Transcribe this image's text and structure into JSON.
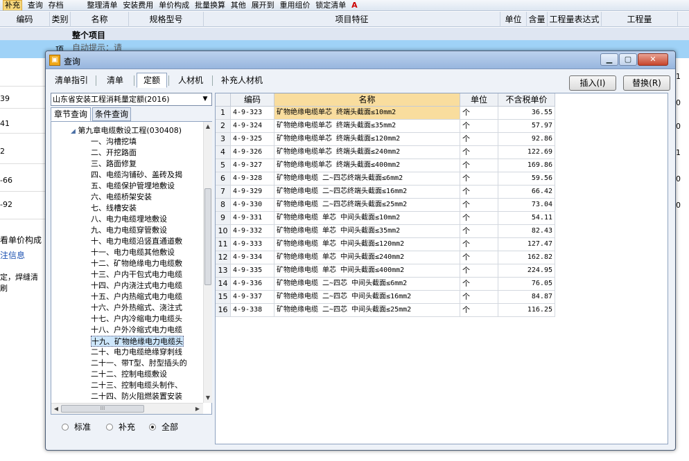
{
  "bg": {
    "toolbar_items": [
      "补充",
      "查询",
      "存档",
      "",
      "整理清单",
      "安装费用",
      "单价构成",
      "批量换算",
      "其他",
      "展开到",
      "重用组价",
      "锁定清单",
      "A"
    ],
    "grid_headers": [
      "编码",
      "类别",
      "名称",
      "规格型号",
      "项目特征",
      "单位",
      "含量",
      "工程量表达式",
      "工程量"
    ],
    "total_row": "整个项目",
    "sel_row": {
      "type": "项",
      "hint": "自动提示：请"
    },
    "left_numbers": [
      "39",
      "41",
      "2",
      "-66",
      "-92"
    ],
    "right_numbers": [
      "1",
      "0",
      "0",
      "0",
      "1",
      "0",
      "0"
    ],
    "left_links": [
      "看单价构成",
      "注信息",
      "定，焊缝清刷"
    ]
  },
  "dialog": {
    "title": "查询",
    "tabs": [
      "清单指引",
      "清单",
      "定额",
      "人材机",
      "补充人材机"
    ],
    "active_tab": "定额",
    "insert_btn": "插入(I)",
    "replace_btn": "替换(R)",
    "library": "山东省安装工程消耗量定额(2016)",
    "left_tabs": [
      "章节查询",
      "条件查询"
    ],
    "tree_root": "第九章电缆敷设工程(030408)",
    "tree_items": [
      "一、沟槽挖填",
      "二、开挖路面",
      "三、路面修复",
      "四、电缆沟铺砂、盖砖及揭",
      "五、电缆保护管埋地敷设",
      "六、电缆桥架安装",
      "七、线槽安装",
      "八、电力电缆埋地敷设",
      "九、电力电缆穿管敷设",
      "十、电力电缆沿竖直通道敷",
      "十一、电力电缆其他敷设",
      "十二、矿物绝缘电力电缆敷",
      "十三、户内干包式电力电缆",
      "十四、户内浇注式电力电缆",
      "十五、户内热缩式电力电缆",
      "十六、户外热缩式、浇注式",
      "十七、户内冷缩电力电缆头",
      "十八、户外冷缩式电力电缆",
      "十九、矿物绝缘电力电缆头",
      "二十、电力电缆绝缘穿刺线",
      "二十一、带T型、肘型插头的",
      "二十二、控制电缆敷设",
      "二十三、控制电缆头制作、",
      "二十四、防火阻燃装置安装"
    ],
    "selected_tree_index": 18,
    "radios": [
      "标准",
      "补充",
      "全部"
    ],
    "radio_selected": "全部",
    "grid_headers": [
      "编码",
      "名称",
      "单位",
      "不含税单价"
    ],
    "rows": [
      {
        "no": "1",
        "code": "4-9-323",
        "name": "矿物绝缘电缆单芯 终端头截面≤10mm2",
        "unit": "个",
        "price": "36.55"
      },
      {
        "no": "2",
        "code": "4-9-324",
        "name": "矿物绝缘电缆单芯 终端头截面≤35mm2",
        "unit": "个",
        "price": "57.97"
      },
      {
        "no": "3",
        "code": "4-9-325",
        "name": "矿物绝缘电缆单芯 终端头截面≤120mm2",
        "unit": "个",
        "price": "92.86"
      },
      {
        "no": "4",
        "code": "4-9-326",
        "name": "矿物绝缘电缆单芯 终端头截面≤240mm2",
        "unit": "个",
        "price": "122.69"
      },
      {
        "no": "5",
        "code": "4-9-327",
        "name": "矿物绝缘电缆单芯 终端头截面≤400mm2",
        "unit": "个",
        "price": "169.86"
      },
      {
        "no": "6",
        "code": "4-9-328",
        "name": "矿物绝缘电缆 二~四芯终端头截面≤6mm2",
        "unit": "个",
        "price": "59.56"
      },
      {
        "no": "7",
        "code": "4-9-329",
        "name": "矿物绝缘电缆 二~四芯终端头截面≤16mm2",
        "unit": "个",
        "price": "66.42"
      },
      {
        "no": "8",
        "code": "4-9-330",
        "name": "矿物绝缘电缆 二~四芯终端头截面≤25mm2",
        "unit": "个",
        "price": "73.04"
      },
      {
        "no": "9",
        "code": "4-9-331",
        "name": "矿物绝缘电缆 单芯 中间头截面≤10mm2",
        "unit": "个",
        "price": "54.11"
      },
      {
        "no": "10",
        "code": "4-9-332",
        "name": "矿物绝缘电缆 单芯 中间头截面≤35mm2",
        "unit": "个",
        "price": "82.43"
      },
      {
        "no": "11",
        "code": "4-9-333",
        "name": "矿物绝缘电缆 单芯 中间头截面≤120mm2",
        "unit": "个",
        "price": "127.47"
      },
      {
        "no": "12",
        "code": "4-9-334",
        "name": "矿物绝缘电缆 单芯 中间头截面≤240mm2",
        "unit": "个",
        "price": "162.82"
      },
      {
        "no": "13",
        "code": "4-9-335",
        "name": "矿物绝缘电缆 单芯 中间头截面≤400mm2",
        "unit": "个",
        "price": "224.95"
      },
      {
        "no": "14",
        "code": "4-9-336",
        "name": "矿物绝缘电缆 二~四芯 中间头截面≤6mm2",
        "unit": "个",
        "price": "76.05"
      },
      {
        "no": "15",
        "code": "4-9-337",
        "name": "矿物绝缘电缆 二~四芯 中间头截面≤16mm2",
        "unit": "个",
        "price": "84.87"
      },
      {
        "no": "16",
        "code": "4-9-338",
        "name": "矿物绝缘电缆 二~四芯 中间头截面≤25mm2",
        "unit": "个",
        "price": "116.25"
      }
    ]
  }
}
